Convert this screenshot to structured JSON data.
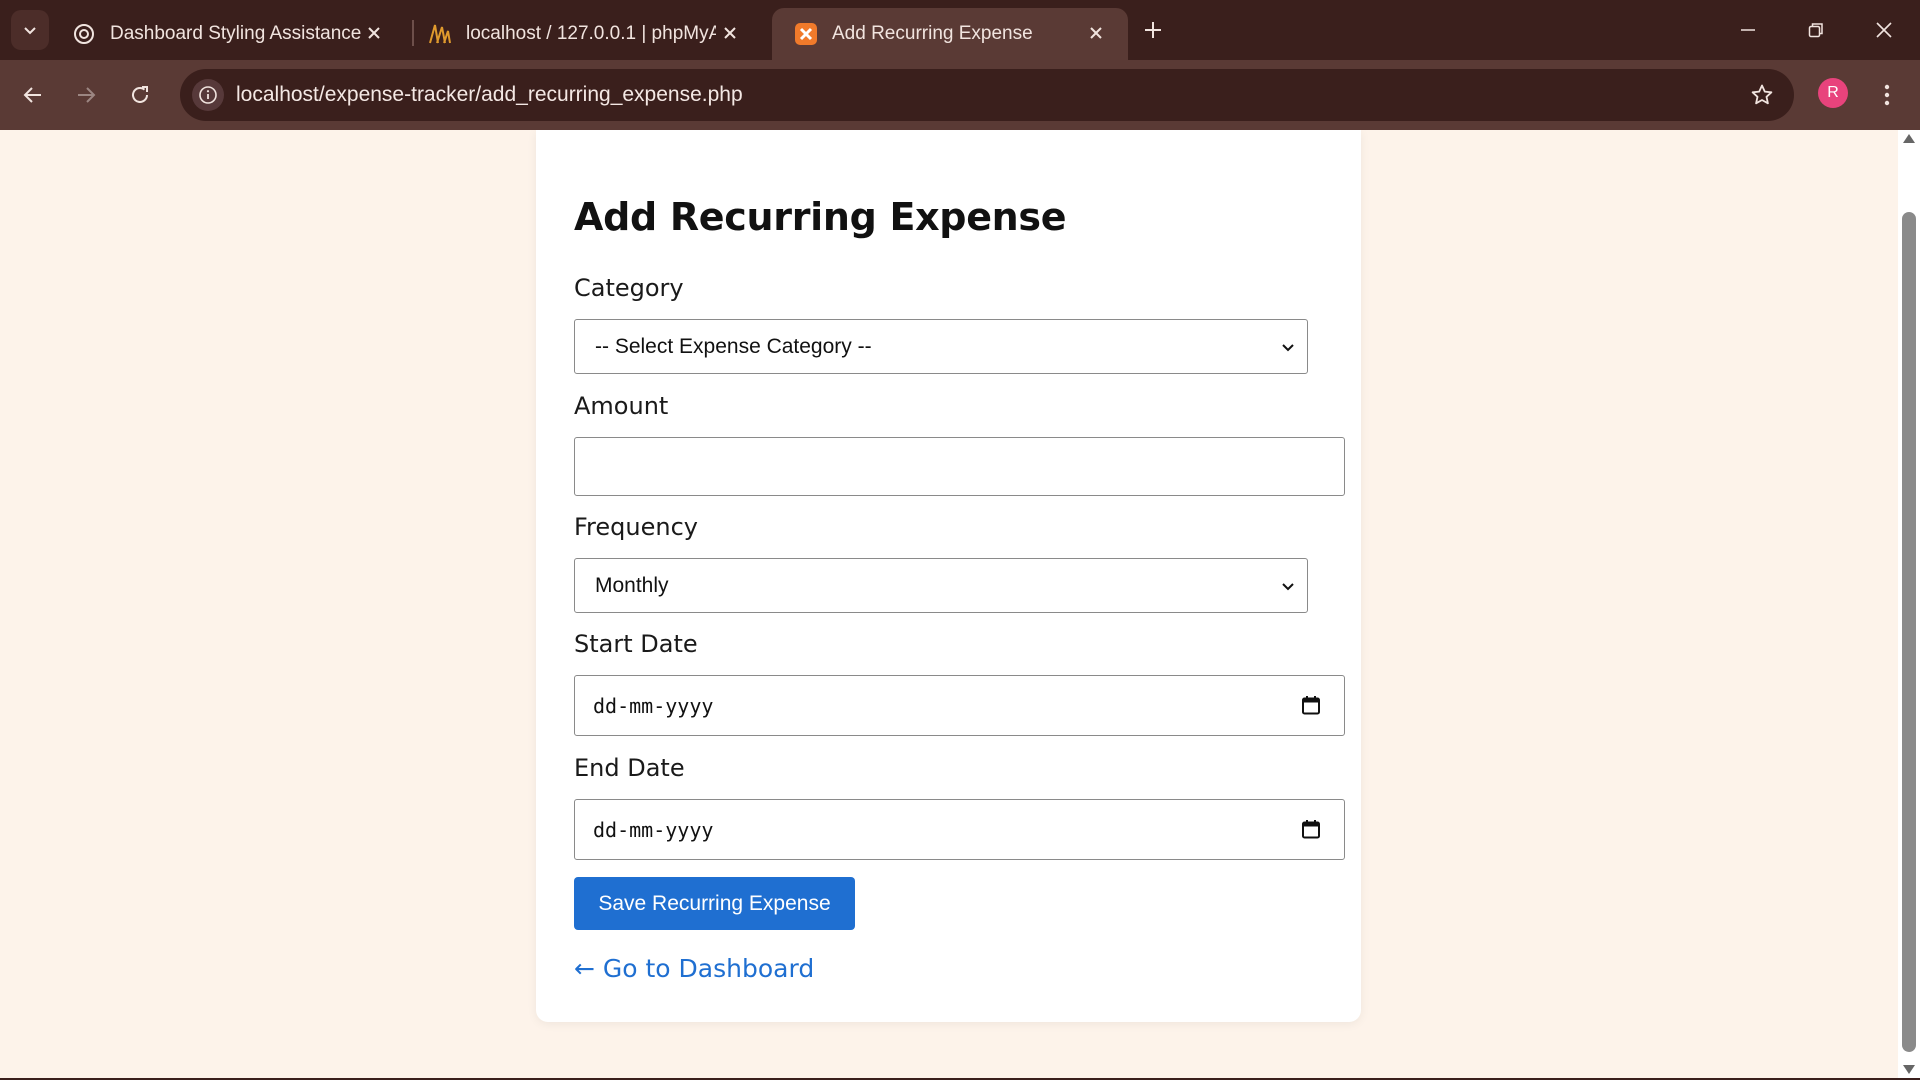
{
  "browser": {
    "tabs": [
      {
        "title": "Dashboard Styling Assistance",
        "icon": "openai-icon",
        "active": false
      },
      {
        "title": "localhost / 127.0.0.1 | phpMyAd",
        "icon": "phpmyadmin-icon",
        "active": false
      },
      {
        "title": "Add Recurring Expense",
        "icon": "xampp-icon",
        "active": true
      }
    ],
    "url": "localhost/expense-tracker/add_recurring_expense.php",
    "profile_initial": "R",
    "colors": {
      "frame": "#3a1f1c",
      "toolbar": "#5a3a35",
      "profile": "#e8437c"
    }
  },
  "page": {
    "title": "Add Recurring Expense",
    "category": {
      "label": "Category",
      "selected": "-- Select Expense Category --"
    },
    "amount": {
      "label": "Amount",
      "value": ""
    },
    "frequency": {
      "label": "Frequency",
      "selected": "Monthly"
    },
    "start_date": {
      "label": "Start Date",
      "placeholder": "dd-mm-yyyy"
    },
    "end_date": {
      "label": "End Date",
      "placeholder": "dd-mm-yyyy"
    },
    "save_label": "Save Recurring Expense",
    "back_link": "← Go to Dashboard",
    "colors": {
      "background": "#fdf3ea",
      "accent": "#1f6fd1"
    }
  }
}
